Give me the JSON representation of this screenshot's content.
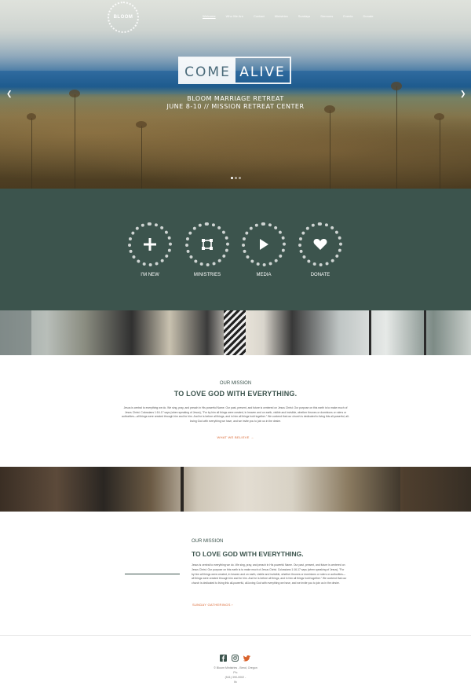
{
  "brand": {
    "logo_text": "BLOOM"
  },
  "nav": [
    "Welcome",
    "Who We Are",
    "Contact",
    "Ministries",
    "Sundays",
    "Sermons",
    "Events",
    "Donate"
  ],
  "hero": {
    "badge_left": "COME",
    "badge_right": "ALIVE",
    "line1": "BLOOM MARRIAGE RETREAT",
    "line2": "JUNE 8-10 // MISSION RETREAT CENTER",
    "slides": 3,
    "active_slide": 1
  },
  "icons": [
    {
      "label": "I'M NEW",
      "icon": "plus-icon"
    },
    {
      "label": "MINISTRIES",
      "icon": "square-nodes-icon"
    },
    {
      "label": "MEDIA",
      "icon": "play-icon"
    },
    {
      "label": "DONATE",
      "icon": "heart-icon"
    }
  ],
  "mission1": {
    "eyebrow": "OUR MISSION",
    "title": "TO LOVE GOD WITH EVERYTHING.",
    "body": "Jesus is central to everything we do. We sing, pray, and preach in His powerful Name. Our past, present, and future is centered on Jesus Christ. Our purpose on this earth is to make much of Jesus Christ. Colossians 1:16-17 says (when speaking of Jesus), \"For by him all things were created, in heaven and on earth, visible and invisible, whether thrones or dominions or rulers or authorities—all things were created through him and for him. And he is before all things, and in him all things hold together.\" We contend that our church is dedicated to living this all-powerful, all-loving God with everything we have, and we invite you to join us in the desire.",
    "link": "WHAT WE BELIEVE"
  },
  "mission2": {
    "eyebrow": "OUR MISSION",
    "title": "TO LOVE GOD WITH EVERYTHING.",
    "body": "Jesus is central to everything we do. We sing, pray, and preach in His powerful Name. Our past, present, and future is centered on Jesus Christ. Our purpose on this earth is to make much of Jesus Christ. Colossians 1:16-17 says (when speaking of Jesus), \"For by him all things were created, in heaven and on earth, visible and invisible, whether thrones or dominions or rulers or authorities—all things were created through him and for him. And he is before all things, and in him all things hold together.\" We contend that our church is dedicated to living this all-powerful, all-loving God with everything we have, and we invite you to join us in the desire.",
    "link": "SUNDAY GATHERINGS"
  },
  "footer": {
    "social": [
      "facebook-icon",
      "instagram-icon",
      "twitter-icon"
    ],
    "line1": "© Bloom Ministries - Bend, Oregon",
    "line2": "Ph:",
    "line3": "(541) 390-0002 -",
    "line4": "Ifc"
  },
  "colors": {
    "green": "#3c544d",
    "accent": "#d9622b",
    "twitter": "#d9622b"
  }
}
